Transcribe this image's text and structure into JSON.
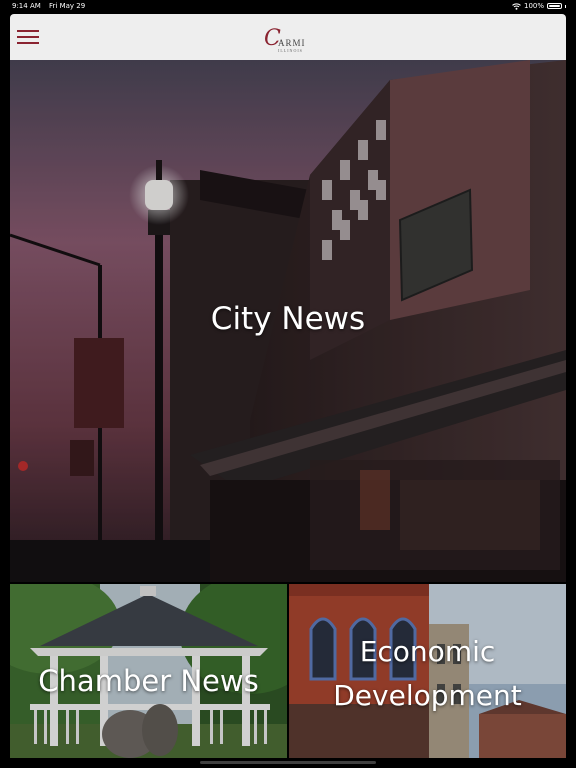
{
  "status_bar": {
    "time": "9:14 AM",
    "date": "Fri May 29",
    "battery": "100%"
  },
  "header": {
    "logo": {
      "script_letter": "C",
      "word": "ARMI",
      "sub": "ILLINOIS"
    }
  },
  "tiles": {
    "city_news": "City News",
    "chamber_news": "Chamber News",
    "economic_line1": "Economic",
    "economic_line2": "Development"
  },
  "colors": {
    "accent": "#8a2330",
    "nav_background": "#eeeeee"
  },
  "icons": {
    "menu": "hamburger-icon",
    "wifi": "wifi-icon",
    "battery": "battery-icon"
  }
}
